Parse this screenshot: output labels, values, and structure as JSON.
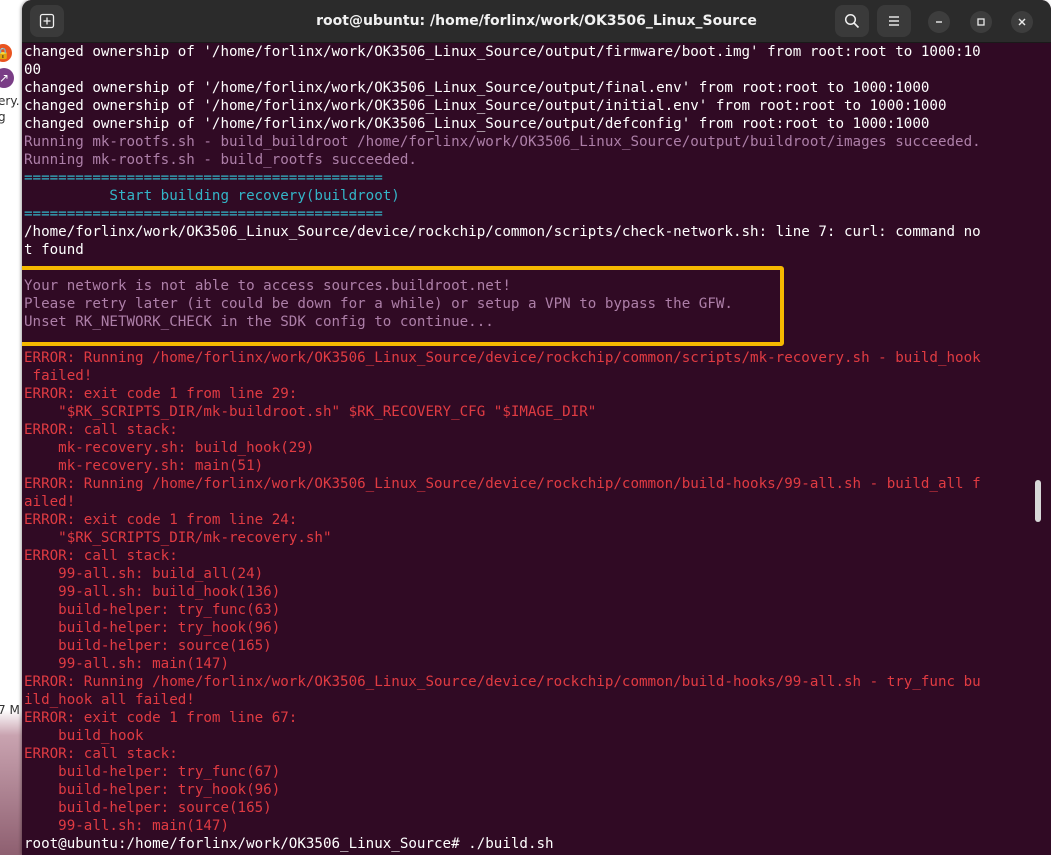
{
  "window": {
    "title": "root@ubuntu: /home/forlinx/work/OK3506_Linux_Source"
  },
  "background": {
    "text1": "ery.",
    "text2": "g",
    "text3": "7 M"
  },
  "colors": {
    "terminal_bg": "#300a24",
    "text_white": "#ffffff",
    "text_purple": "#ad7fa8",
    "text_cyan": "#34b5c8",
    "text_red": "#e03b42",
    "highlight_border": "#f5b800"
  },
  "icons": {
    "new_tab": "new-tab-icon",
    "search": "search-icon",
    "menu": "hamburger-menu-icon",
    "minimize": "minimize-icon",
    "maximize": "maximize-icon",
    "close": "close-icon"
  },
  "terminal": {
    "lines": [
      {
        "text": "changed ownership of '/home/forlinx/work/OK3506_Linux_Source/output/firmware/boot.img' from root:root to 1000:10",
        "color": "white"
      },
      {
        "text": "00",
        "color": "white"
      },
      {
        "text": "changed ownership of '/home/forlinx/work/OK3506_Linux_Source/output/final.env' from root:root to 1000:1000",
        "color": "white"
      },
      {
        "text": "changed ownership of '/home/forlinx/work/OK3506_Linux_Source/output/initial.env' from root:root to 1000:1000",
        "color": "white"
      },
      {
        "text": "changed ownership of '/home/forlinx/work/OK3506_Linux_Source/output/defconfig' from root:root to 1000:1000",
        "color": "white"
      },
      {
        "text": "Running mk-rootfs.sh - build_buildroot /home/forlinx/work/OK3506_Linux_Source/output/buildroot/images succeeded.",
        "color": "purple"
      },
      {
        "text": "Running mk-rootfs.sh - build_rootfs succeeded.",
        "color": "purple"
      },
      {
        "text": "==========================================",
        "color": "cyan"
      },
      {
        "text": "          Start building recovery(buildroot)",
        "color": "cyan"
      },
      {
        "text": "==========================================",
        "color": "cyan"
      },
      {
        "text": "/home/forlinx/work/OK3506_Linux_Source/device/rockchip/common/scripts/check-network.sh: line 7: curl: command no",
        "color": "white"
      },
      {
        "text": "t found",
        "color": "white"
      },
      {
        "text": "",
        "color": "white"
      },
      {
        "text": "Your network is not able to access sources.buildroot.net!",
        "color": "purple"
      },
      {
        "text": "Please retry later (it could be down for a while) or setup a VPN to bypass the GFW.",
        "color": "purple"
      },
      {
        "text": "Unset RK_NETWORK_CHECK in the SDK config to continue...",
        "color": "purple"
      },
      {
        "text": "",
        "color": "white"
      },
      {
        "text": "ERROR: Running /home/forlinx/work/OK3506_Linux_Source/device/rockchip/common/scripts/mk-recovery.sh - build_hook",
        "color": "red"
      },
      {
        "text": " failed!",
        "color": "red"
      },
      {
        "text": "ERROR: exit code 1 from line 29:",
        "color": "red"
      },
      {
        "text": "    \"$RK_SCRIPTS_DIR/mk-buildroot.sh\" $RK_RECOVERY_CFG \"$IMAGE_DIR\"",
        "color": "red"
      },
      {
        "text": "ERROR: call stack:",
        "color": "red"
      },
      {
        "text": "    mk-recovery.sh: build_hook(29)",
        "color": "red"
      },
      {
        "text": "    mk-recovery.sh: main(51)",
        "color": "red"
      },
      {
        "text": "ERROR: Running /home/forlinx/work/OK3506_Linux_Source/device/rockchip/common/build-hooks/99-all.sh - build_all f",
        "color": "red"
      },
      {
        "text": "ailed!",
        "color": "red"
      },
      {
        "text": "ERROR: exit code 1 from line 24:",
        "color": "red"
      },
      {
        "text": "    \"$RK_SCRIPTS_DIR/mk-recovery.sh\"",
        "color": "red"
      },
      {
        "text": "ERROR: call stack:",
        "color": "red"
      },
      {
        "text": "    99-all.sh: build_all(24)",
        "color": "red"
      },
      {
        "text": "    99-all.sh: build_hook(136)",
        "color": "red"
      },
      {
        "text": "    build-helper: try_func(63)",
        "color": "red"
      },
      {
        "text": "    build-helper: try_hook(96)",
        "color": "red"
      },
      {
        "text": "    build-helper: source(165)",
        "color": "red"
      },
      {
        "text": "    99-all.sh: main(147)",
        "color": "red"
      },
      {
        "text": "ERROR: Running /home/forlinx/work/OK3506_Linux_Source/device/rockchip/common/build-hooks/99-all.sh - try_func bu",
        "color": "red"
      },
      {
        "text": "ild_hook all failed!",
        "color": "red"
      },
      {
        "text": "ERROR: exit code 1 from line 67:",
        "color": "red"
      },
      {
        "text": "    build_hook",
        "color": "red"
      },
      {
        "text": "ERROR: call stack:",
        "color": "red"
      },
      {
        "text": "    build-helper: try_func(67)",
        "color": "red"
      },
      {
        "text": "    build-helper: try_hook(96)",
        "color": "red"
      },
      {
        "text": "    build-helper: source(165)",
        "color": "red"
      },
      {
        "text": "    99-all.sh: main(147)",
        "color": "red"
      },
      {
        "text": "root@ubuntu:/home/forlinx/work/OK3506_Linux_Source# ./build.sh",
        "color": "white"
      }
    ]
  }
}
